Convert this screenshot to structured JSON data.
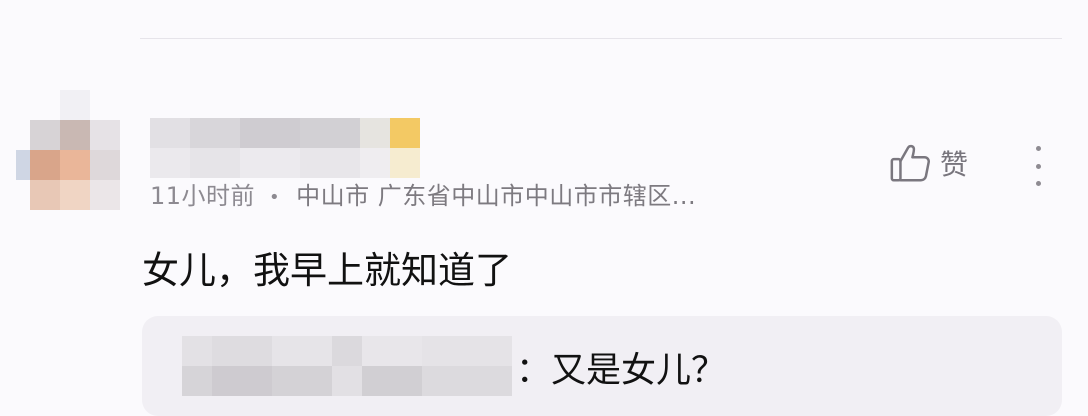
{
  "comment": {
    "meta": {
      "time": "11小时前",
      "separator": "•",
      "location": "中山市 广东省中山市中山市市辖区..."
    },
    "text": "女儿，我早上就知道了",
    "like": {
      "icon": "thumbs-up-icon",
      "label": "赞"
    },
    "more_icon": "more-vertical-icon",
    "reply": {
      "text": "：又是女儿？"
    }
  },
  "colors": {
    "background": "#fbfafd",
    "meta_text": "#8d8a91",
    "reply_background": "#f1eff4"
  }
}
